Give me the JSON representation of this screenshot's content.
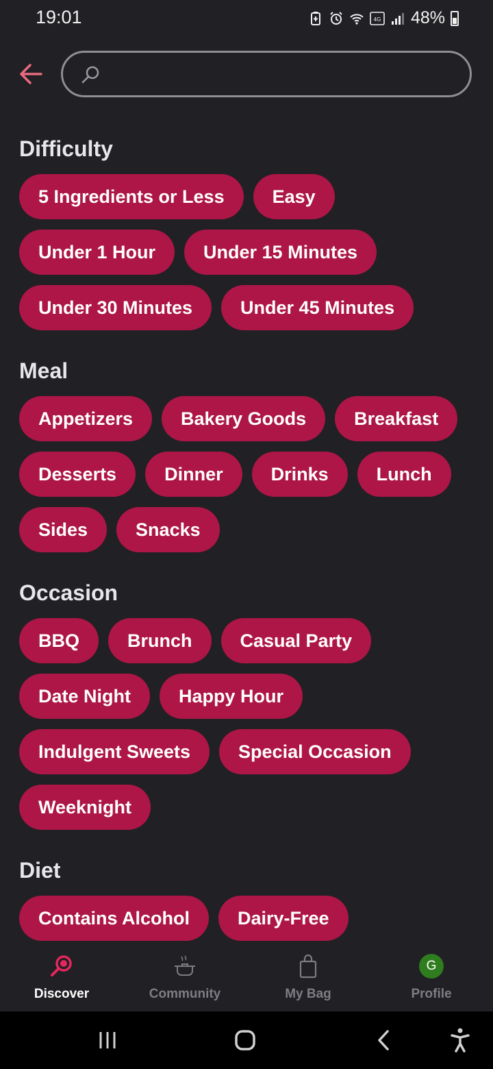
{
  "status_bar": {
    "time": "19:01",
    "battery": "48%",
    "icons": [
      "battery-saver-icon",
      "alarm-icon",
      "wifi-icon",
      "volte-4g-icon",
      "signal-icon"
    ]
  },
  "header": {
    "back_icon": "arrow-left-icon",
    "search": {
      "placeholder": "",
      "value": ""
    }
  },
  "sections": [
    {
      "title": "Difficulty",
      "chips": [
        "5 Ingredients or Less",
        "Easy",
        "Under 1 Hour",
        "Under 15 Minutes",
        "Under 30 Minutes",
        "Under 45 Minutes"
      ]
    },
    {
      "title": "Meal",
      "chips": [
        "Appetizers",
        "Bakery Goods",
        "Breakfast",
        "Desserts",
        "Dinner",
        "Drinks",
        "Lunch",
        "Sides",
        "Snacks"
      ]
    },
    {
      "title": "Occasion",
      "chips": [
        "BBQ",
        "Brunch",
        "Casual Party",
        "Date Night",
        "Happy Hour",
        "Indulgent Sweets",
        "Special Occasion",
        "Weeknight"
      ]
    },
    {
      "title": "Diet",
      "chips": [
        "Contains Alcohol",
        "Dairy-Free"
      ]
    }
  ],
  "bottom_nav": [
    {
      "label": "Discover",
      "icon": "magnifier-icon",
      "active": true
    },
    {
      "label": "Community",
      "icon": "pot-icon",
      "active": false
    },
    {
      "label": "My Bag",
      "icon": "bag-icon",
      "active": false
    },
    {
      "label": "Profile",
      "icon": "avatar",
      "avatar_letter": "G",
      "active": false
    }
  ],
  "colors": {
    "accent": "#ad1646",
    "background": "#212024",
    "back_arrow": "#e86a7e",
    "avatar": "#2f7d1e"
  }
}
